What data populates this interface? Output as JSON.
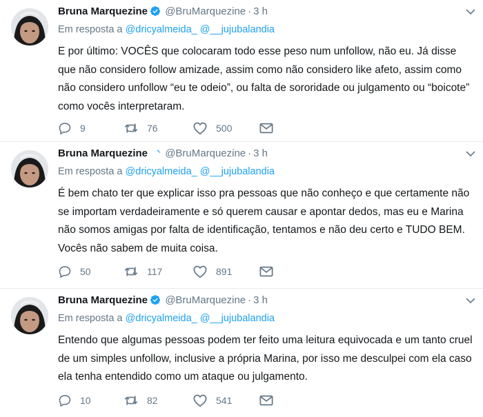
{
  "tweets": [
    {
      "name": "Bruna Marquezine",
      "handle": "@BruMarquezine",
      "separator": "·",
      "time": "3 h",
      "reply_prefix": "Em resposta a",
      "reply_to_1": "@dricyalmeida_",
      "reply_to_2": "@__jujubalandia",
      "text": "E por último: VOCÊS que colocaram todo esse peso num unfollow, não eu. Já disse que não considero follow amizade, assim como não considero like afeto, assim como não considero unfollow “eu te odeio”, ou falta de sororidade ou julgamento ou “boicote” como vocês interpretaram.",
      "replies": "9",
      "retweets": "76",
      "likes": "500"
    },
    {
      "name": "Bruna Marquezine",
      "handle": "@BruMarquezine",
      "separator": "·",
      "time": "3 h",
      "reply_prefix": "Em resposta a",
      "reply_to_1": "@dricyalmeida_",
      "reply_to_2": "@__jujubalandia",
      "text": "É bem chato ter que explicar isso pra pessoas que não conheço e que certamente não se importam verdadeiramente e só querem causar e apontar dedos, mas eu e Marina não somos amigas por falta de identificação, tentamos e não deu certo e TUDO BEM. Vocês não sabem de muita coisa.",
      "replies": "50",
      "retweets": "117",
      "likes": "891"
    },
    {
      "name": "Bruna Marquezine",
      "handle": "@BruMarquezine",
      "separator": "·",
      "time": "3 h",
      "reply_prefix": "Em resposta a",
      "reply_to_1": "@dricyalmeida_",
      "reply_to_2": "@__jujubalandia",
      "text": "Entendo que algumas pessoas podem ter feito uma leitura equivocada e um tanto cruel de um simples unfollow, inclusive a própria Marina, por isso me desculpei com ela caso ela tenha entendido como um ataque ou julgamento.",
      "replies": "10",
      "retweets": "82",
      "likes": "541"
    }
  ],
  "icons": {
    "verified": "verified-badge-icon",
    "more": "chevron-down-icon",
    "reply": "reply-icon",
    "retweet": "retweet-icon",
    "like": "heart-icon",
    "dm": "envelope-icon"
  },
  "colors": {
    "link": "#1da1f2",
    "muted": "#657786",
    "text": "#14171a",
    "divider": "#e6ecf0"
  }
}
